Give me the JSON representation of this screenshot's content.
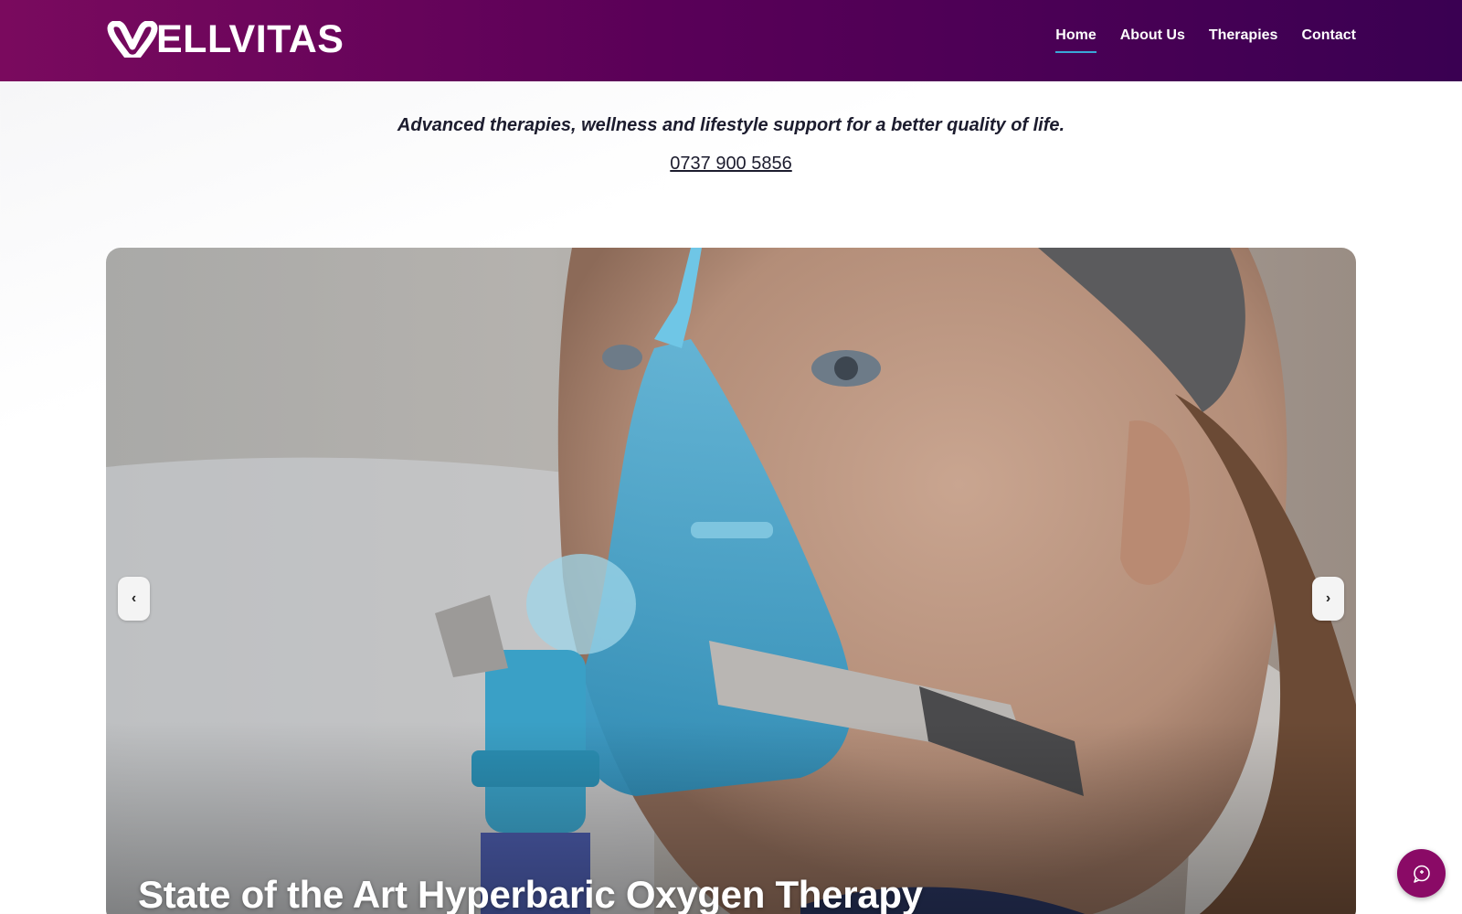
{
  "header": {
    "logo_text": "ELLVITAS",
    "logo_alt": "WELLVITAS",
    "nav": [
      {
        "label": "Home",
        "active": true
      },
      {
        "label": "About Us",
        "active": false
      },
      {
        "label": "Therapies",
        "active": false
      },
      {
        "label": "Contact",
        "active": false
      }
    ]
  },
  "intro": {
    "tagline": "Advanced therapies, wellness and lifestyle support for a better quality of life.",
    "phone": "0737 900 5856"
  },
  "hero": {
    "prev_label": "‹",
    "next_label": "›",
    "slide_title": "State of the Art Hyperbaric Oxygen Therapy"
  },
  "chat": {
    "icon": "chat-bubble-icon"
  },
  "colors": {
    "header_start": "#7a0a5e",
    "header_end": "#3a0052",
    "nav_active_underline": "#3aa8d8",
    "chat_button": "#8a0a66"
  }
}
